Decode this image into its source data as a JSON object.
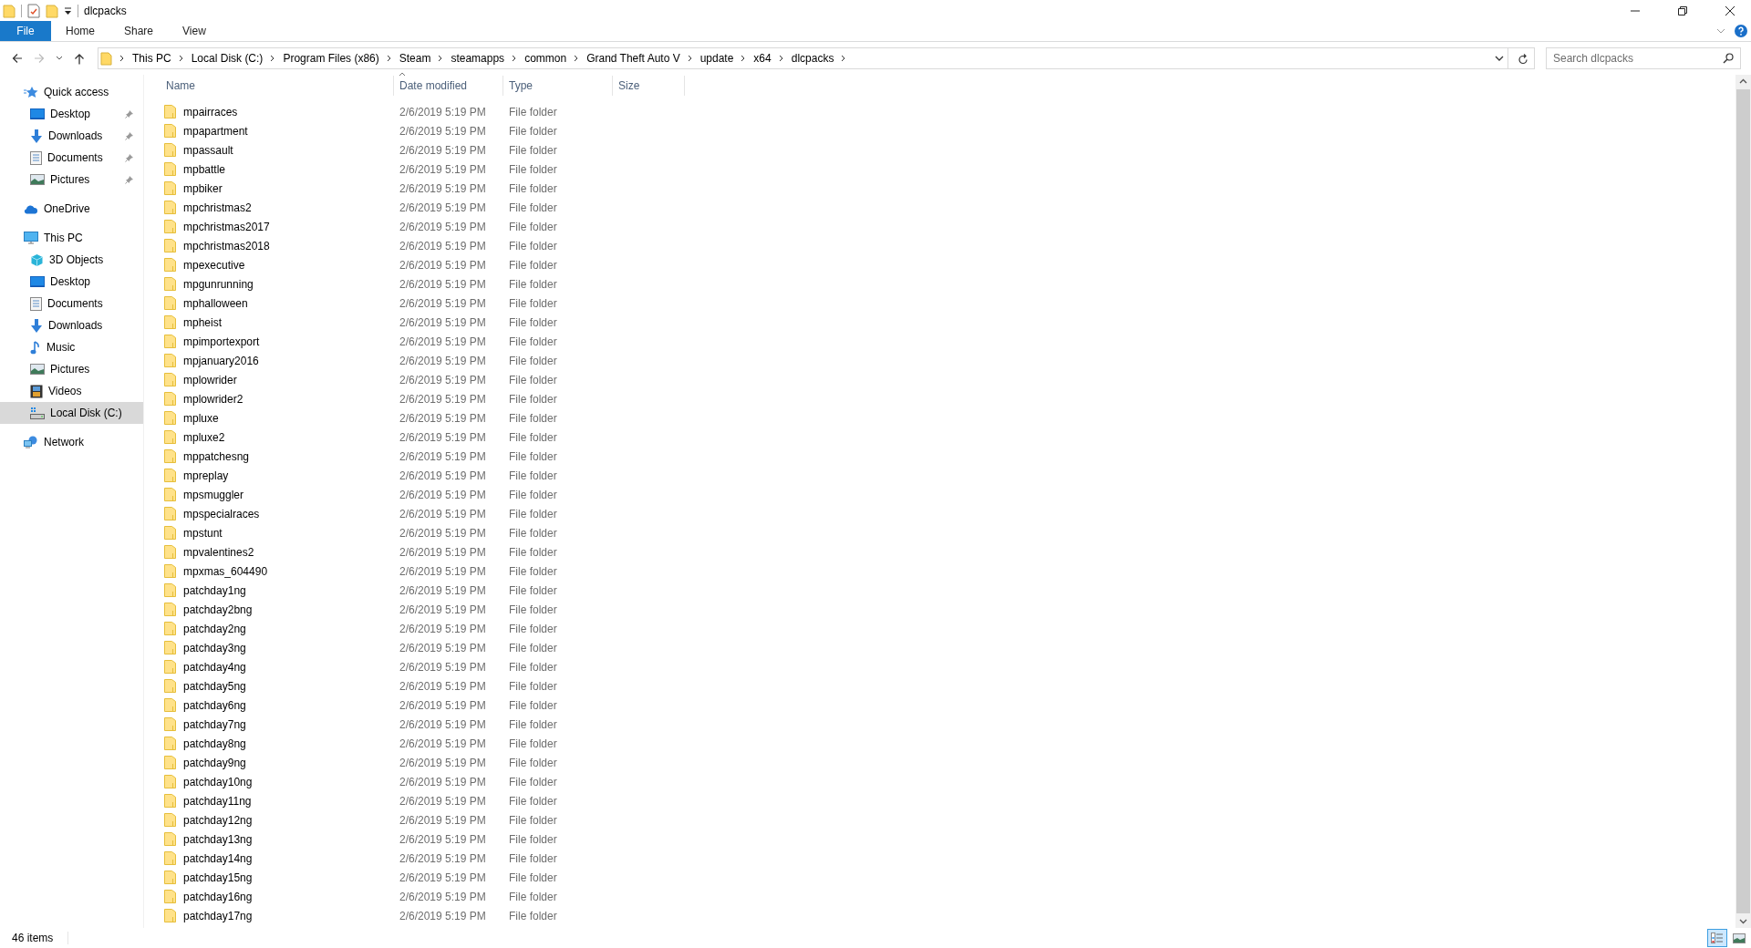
{
  "window": {
    "title": "dlcpacks"
  },
  "ribbon_tabs": [
    {
      "label": "File",
      "selected": true
    },
    {
      "label": "Home",
      "selected": false
    },
    {
      "label": "Share",
      "selected": false
    },
    {
      "label": "View",
      "selected": false
    }
  ],
  "breadcrumb": [
    "This PC",
    "Local Disk (C:)",
    "Program Files (x86)",
    "Steam",
    "steamapps",
    "common",
    "Grand Theft Auto V",
    "update",
    "x64",
    "dlcpacks"
  ],
  "search": {
    "placeholder": "Search dlcpacks"
  },
  "sidebar": {
    "items": [
      {
        "label": "Quick access",
        "kind": "quick",
        "selected": false,
        "children": [
          {
            "label": "Desktop",
            "kind": "desktop",
            "selected": false,
            "pinned": true
          },
          {
            "label": "Downloads",
            "kind": "downloads",
            "selected": false,
            "pinned": true
          },
          {
            "label": "Documents",
            "kind": "documents",
            "selected": false,
            "pinned": true
          },
          {
            "label": "Pictures",
            "kind": "pictures",
            "selected": false,
            "pinned": true
          }
        ]
      },
      {
        "label": "OneDrive",
        "kind": "cloud",
        "selected": false
      },
      {
        "label": "This PC",
        "kind": "pc",
        "selected": false,
        "children": [
          {
            "label": "3D Objects",
            "kind": "cube",
            "selected": false,
            "pinned": false
          },
          {
            "label": "Desktop",
            "kind": "desktop",
            "selected": false,
            "pinned": false
          },
          {
            "label": "Documents",
            "kind": "documents",
            "selected": false,
            "pinned": false
          },
          {
            "label": "Downloads",
            "kind": "downloads",
            "selected": false,
            "pinned": false
          },
          {
            "label": "Music",
            "kind": "music",
            "selected": false,
            "pinned": false
          },
          {
            "label": "Pictures",
            "kind": "pictures",
            "selected": false,
            "pinned": false
          },
          {
            "label": "Videos",
            "kind": "videos",
            "selected": false,
            "pinned": false
          },
          {
            "label": "Local Disk (C:)",
            "kind": "disk",
            "selected": true,
            "pinned": false
          }
        ]
      },
      {
        "label": "Network",
        "kind": "network",
        "selected": false
      }
    ]
  },
  "table": {
    "columns": [
      "Name",
      "Date modified",
      "Type",
      "Size"
    ],
    "rows": [
      {
        "name": "mpairraces",
        "date": "2/6/2019 5:19 PM",
        "type": "File folder"
      },
      {
        "name": "mpapartment",
        "date": "2/6/2019 5:19 PM",
        "type": "File folder"
      },
      {
        "name": "mpassault",
        "date": "2/6/2019 5:19 PM",
        "type": "File folder"
      },
      {
        "name": "mpbattle",
        "date": "2/6/2019 5:19 PM",
        "type": "File folder"
      },
      {
        "name": "mpbiker",
        "date": "2/6/2019 5:19 PM",
        "type": "File folder"
      },
      {
        "name": "mpchristmas2",
        "date": "2/6/2019 5:19 PM",
        "type": "File folder"
      },
      {
        "name": "mpchristmas2017",
        "date": "2/6/2019 5:19 PM",
        "type": "File folder"
      },
      {
        "name": "mpchristmas2018",
        "date": "2/6/2019 5:19 PM",
        "type": "File folder"
      },
      {
        "name": "mpexecutive",
        "date": "2/6/2019 5:19 PM",
        "type": "File folder"
      },
      {
        "name": "mpgunrunning",
        "date": "2/6/2019 5:19 PM",
        "type": "File folder"
      },
      {
        "name": "mphalloween",
        "date": "2/6/2019 5:19 PM",
        "type": "File folder"
      },
      {
        "name": "mpheist",
        "date": "2/6/2019 5:19 PM",
        "type": "File folder"
      },
      {
        "name": "mpimportexport",
        "date": "2/6/2019 5:19 PM",
        "type": "File folder"
      },
      {
        "name": "mpjanuary2016",
        "date": "2/6/2019 5:19 PM",
        "type": "File folder"
      },
      {
        "name": "mplowrider",
        "date": "2/6/2019 5:19 PM",
        "type": "File folder"
      },
      {
        "name": "mplowrider2",
        "date": "2/6/2019 5:19 PM",
        "type": "File folder"
      },
      {
        "name": "mpluxe",
        "date": "2/6/2019 5:19 PM",
        "type": "File folder"
      },
      {
        "name": "mpluxe2",
        "date": "2/6/2019 5:19 PM",
        "type": "File folder"
      },
      {
        "name": "mppatchesng",
        "date": "2/6/2019 5:19 PM",
        "type": "File folder"
      },
      {
        "name": "mpreplay",
        "date": "2/6/2019 5:19 PM",
        "type": "File folder"
      },
      {
        "name": "mpsmuggler",
        "date": "2/6/2019 5:19 PM",
        "type": "File folder"
      },
      {
        "name": "mpspecialraces",
        "date": "2/6/2019 5:19 PM",
        "type": "File folder"
      },
      {
        "name": "mpstunt",
        "date": "2/6/2019 5:19 PM",
        "type": "File folder"
      },
      {
        "name": "mpvalentines2",
        "date": "2/6/2019 5:19 PM",
        "type": "File folder"
      },
      {
        "name": "mpxmas_604490",
        "date": "2/6/2019 5:19 PM",
        "type": "File folder"
      },
      {
        "name": "patchday1ng",
        "date": "2/6/2019 5:19 PM",
        "type": "File folder"
      },
      {
        "name": "patchday2bng",
        "date": "2/6/2019 5:19 PM",
        "type": "File folder"
      },
      {
        "name": "patchday2ng",
        "date": "2/6/2019 5:19 PM",
        "type": "File folder"
      },
      {
        "name": "patchday3ng",
        "date": "2/6/2019 5:19 PM",
        "type": "File folder"
      },
      {
        "name": "patchday4ng",
        "date": "2/6/2019 5:19 PM",
        "type": "File folder"
      },
      {
        "name": "patchday5ng",
        "date": "2/6/2019 5:19 PM",
        "type": "File folder"
      },
      {
        "name": "patchday6ng",
        "date": "2/6/2019 5:19 PM",
        "type": "File folder"
      },
      {
        "name": "patchday7ng",
        "date": "2/6/2019 5:19 PM",
        "type": "File folder"
      },
      {
        "name": "patchday8ng",
        "date": "2/6/2019 5:19 PM",
        "type": "File folder"
      },
      {
        "name": "patchday9ng",
        "date": "2/6/2019 5:19 PM",
        "type": "File folder"
      },
      {
        "name": "patchday10ng",
        "date": "2/6/2019 5:19 PM",
        "type": "File folder"
      },
      {
        "name": "patchday11ng",
        "date": "2/6/2019 5:19 PM",
        "type": "File folder"
      },
      {
        "name": "patchday12ng",
        "date": "2/6/2019 5:19 PM",
        "type": "File folder"
      },
      {
        "name": "patchday13ng",
        "date": "2/6/2019 5:19 PM",
        "type": "File folder"
      },
      {
        "name": "patchday14ng",
        "date": "2/6/2019 5:19 PM",
        "type": "File folder"
      },
      {
        "name": "patchday15ng",
        "date": "2/6/2019 5:19 PM",
        "type": "File folder"
      },
      {
        "name": "patchday16ng",
        "date": "2/6/2019 5:19 PM",
        "type": "File folder"
      },
      {
        "name": "patchday17ng",
        "date": "2/6/2019 5:19 PM",
        "type": "File folder"
      }
    ]
  },
  "status_bar": {
    "count": "46 items"
  },
  "view_buttons": [
    {
      "kind": "details",
      "selected": true
    },
    {
      "kind": "thumbnails",
      "selected": false
    }
  ]
}
